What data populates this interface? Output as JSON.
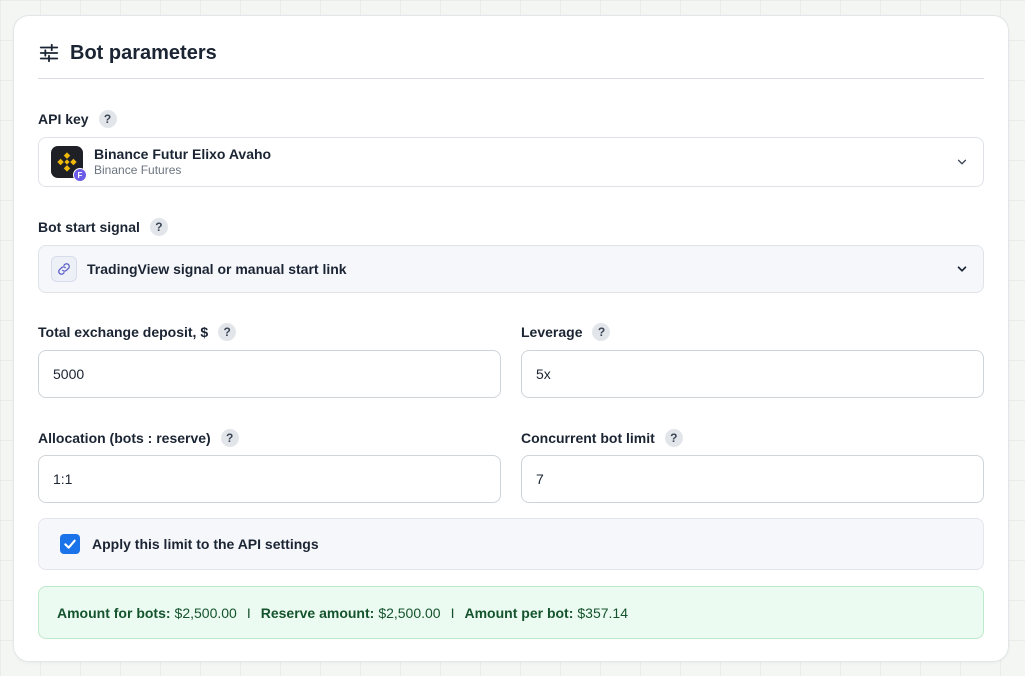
{
  "card": {
    "title": "Bot parameters",
    "title_icon": "sliders-icon"
  },
  "api_key": {
    "label": "API key",
    "help": "?",
    "selected_name": "Binance Futur Elixo Avaho",
    "selected_exchange": "Binance Futures",
    "logo_icon": "binance-logo-icon",
    "badge": "F"
  },
  "start_signal": {
    "label": "Bot start signal",
    "help": "?",
    "selected": "TradingView signal or manual start link",
    "icon": "link-icon"
  },
  "deposit": {
    "label": "Total exchange deposit, $",
    "help": "?",
    "value": "5000"
  },
  "leverage": {
    "label": "Leverage",
    "help": "?",
    "value": "5x"
  },
  "allocation": {
    "label": "Allocation (bots : reserve)",
    "help": "?",
    "value": "1:1"
  },
  "concurrent": {
    "label": "Concurrent bot limit",
    "help": "?",
    "value": "7"
  },
  "apply_limit": {
    "label": "Apply this limit to the API settings",
    "checked": true
  },
  "summary": {
    "bots_label": "Amount for bots:",
    "bots_value": "$2,500.00",
    "reserve_label": "Reserve amount:",
    "reserve_value": "$2,500.00",
    "per_bot_label": "Amount per bot:",
    "per_bot_value": "$357.14",
    "separator": "I"
  },
  "colors": {
    "accent": "#1a73e8",
    "summary_bg": "#ecfbf1",
    "binance_yellow": "#f0b90b"
  }
}
